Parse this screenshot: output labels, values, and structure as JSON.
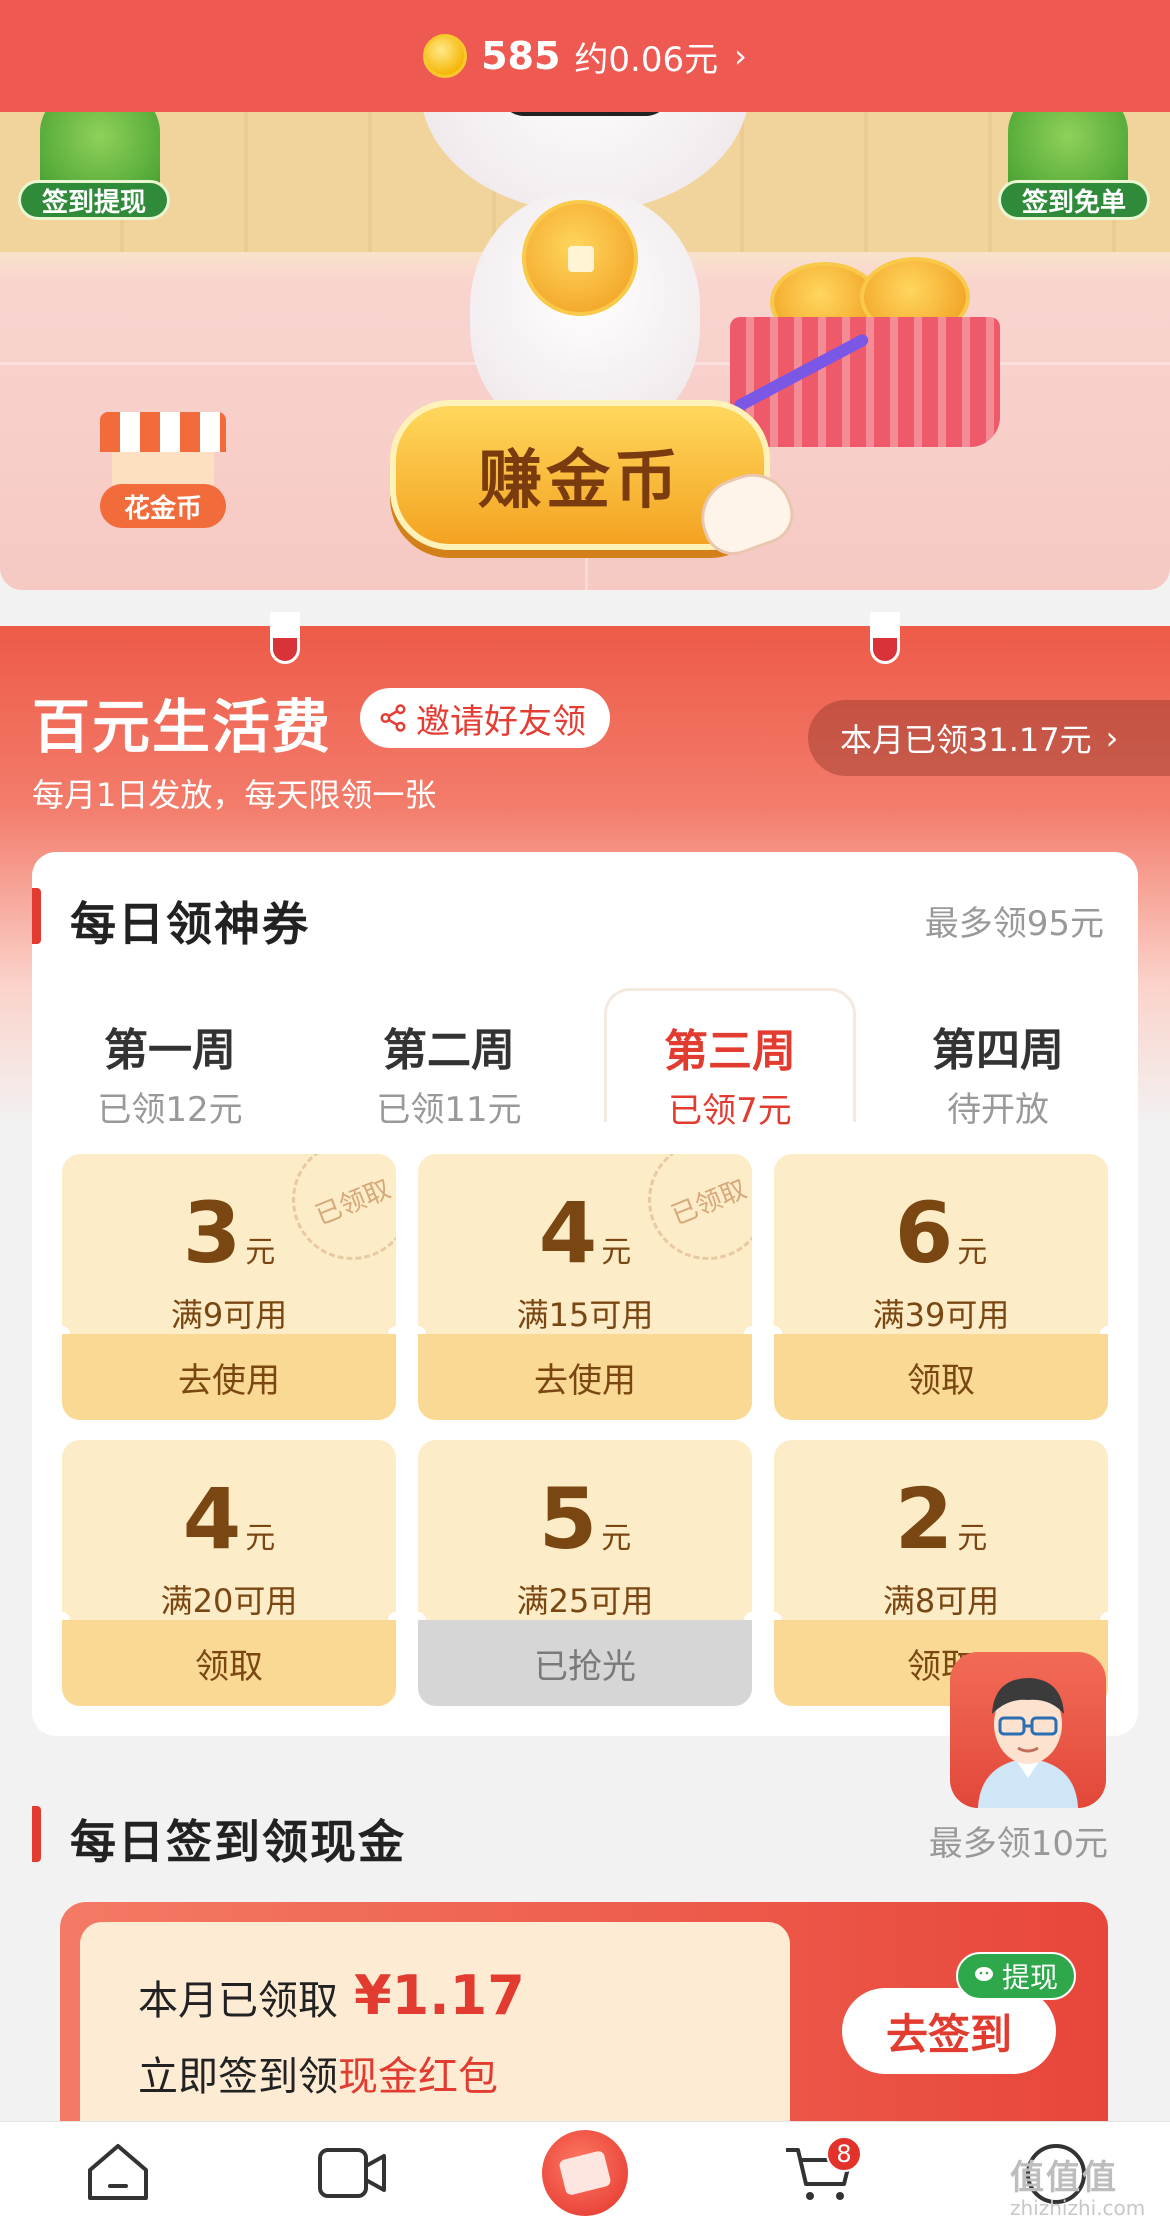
{
  "coin_bar": {
    "count": "585",
    "approx": "约0.06元",
    "chevron": "›"
  },
  "banner": {
    "left_badge": "签到提现",
    "right_badge": "签到免单",
    "earn_button": "赚金币",
    "spend_badge": "花金币"
  },
  "life_fee": {
    "title": "百元生活费",
    "invite": "邀请好友领",
    "subtitle": "每月1日发放，每天限领一张",
    "month_claimed": "本月已领31.17元",
    "chevron": "›"
  },
  "daily_coupon": {
    "title": "每日领神券",
    "max": "最多领95元",
    "weeks": [
      {
        "name": "第一周",
        "status": "已领12元"
      },
      {
        "name": "第二周",
        "status": "已领11元"
      },
      {
        "name": "第三周",
        "status": "已领7元"
      },
      {
        "name": "第四周",
        "status": "待开放"
      }
    ],
    "active_week": 2,
    "coupons": [
      {
        "amount": "3",
        "unit": "元",
        "condition": "满9可用",
        "action": "去使用",
        "stamp": "已领取"
      },
      {
        "amount": "4",
        "unit": "元",
        "condition": "满15可用",
        "action": "去使用",
        "stamp": "已领取"
      },
      {
        "amount": "6",
        "unit": "元",
        "condition": "满39可用",
        "action": "领取"
      },
      {
        "amount": "4",
        "unit": "元",
        "condition": "满20可用",
        "action": "领取"
      },
      {
        "amount": "5",
        "unit": "元",
        "condition": "满25可用",
        "action": "已抢光"
      },
      {
        "amount": "2",
        "unit": "元",
        "condition": "满8可用",
        "action": "领取"
      }
    ]
  },
  "daily_sign": {
    "title": "每日签到领现金",
    "max": "最多领10元",
    "claimed_label": "本月已领取",
    "claimed_amount": "¥1.17",
    "line2_prefix": "立即签到领",
    "line2_highlight": "现金红包",
    "button": "去签到",
    "withdraw_tag": "提现"
  },
  "tabbar": {
    "cart_badge": "8"
  },
  "watermark": {
    "text": "值值值",
    "url": "zhizhizhi.com"
  },
  "colors": {
    "accent_red": "#e23b30",
    "coin_bar": "#ee5a52",
    "coupon_bg": "#fdecc8",
    "wechat_green": "#2ea84a"
  }
}
